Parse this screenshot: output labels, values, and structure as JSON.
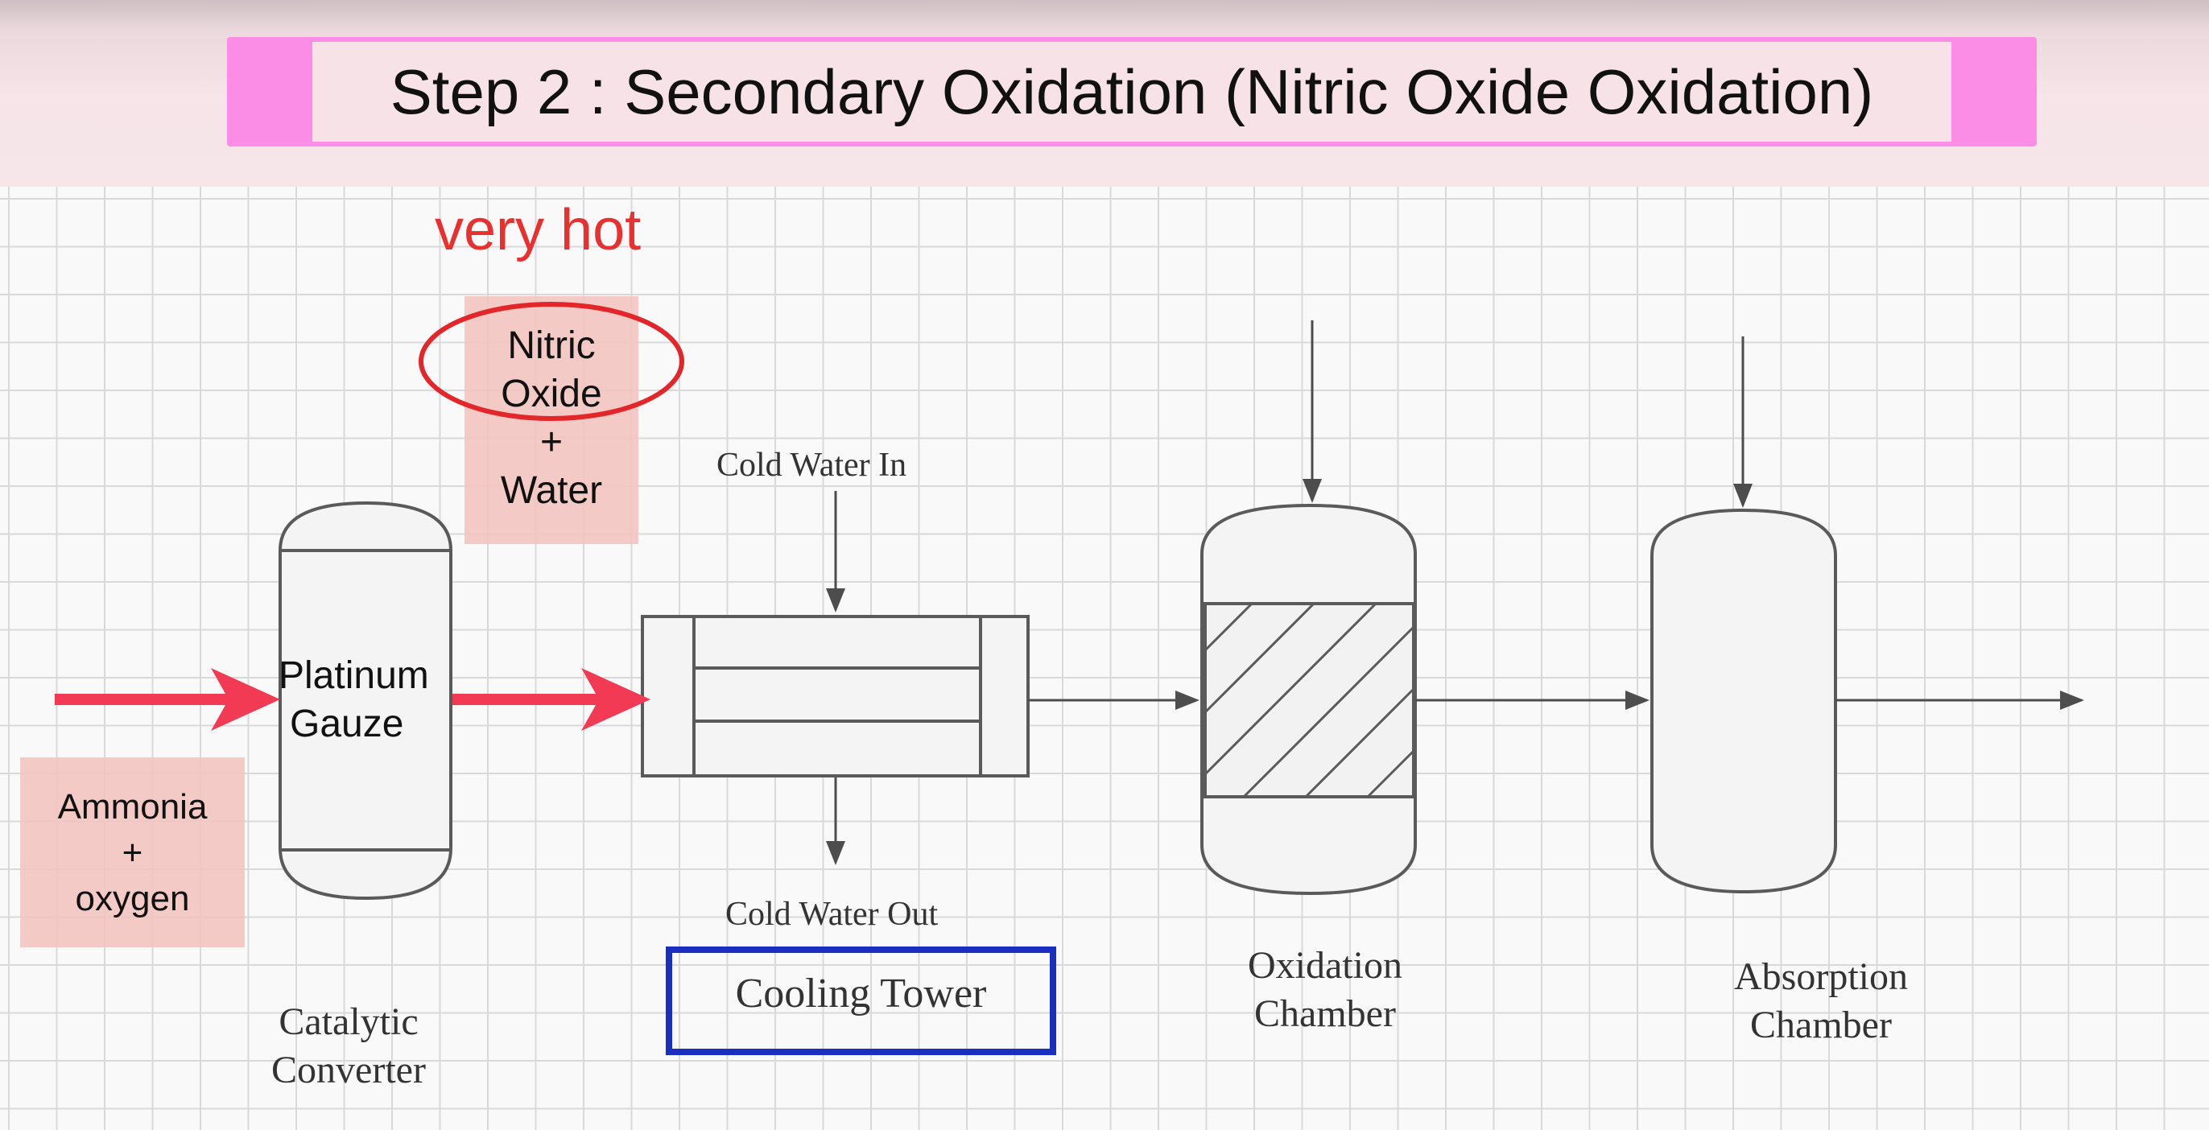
{
  "title": "Step 2 : Secondary Oxidation (Nitric Oxide Oxidation)",
  "annotation": {
    "text": "very hot",
    "color": "#e8312f"
  },
  "notes": {
    "product": {
      "lines": [
        "Nitric",
        "Oxide",
        "+",
        "Water"
      ]
    },
    "feed": {
      "lines": [
        "Ammonia",
        "+",
        "oxygen"
      ]
    }
  },
  "catalyst_label": {
    "lines": [
      "Platinum",
      "Gauze"
    ]
  },
  "cooling": {
    "water_in": "Cold Water In",
    "water_out": "Cold Water Out",
    "name": "Cooling Tower"
  },
  "equipment": {
    "converter": {
      "lines": [
        "Catalytic",
        "Converter"
      ]
    },
    "oxidation": {
      "lines": [
        "Oxidation",
        "Chamber"
      ]
    },
    "absorption": {
      "lines": [
        "Absorption",
        "Chamber"
      ]
    }
  },
  "colors": {
    "title_frame": "#fb8de6",
    "title_box": "#f7e3e7",
    "highlight_arrow": "#f23a55",
    "circle": "#e3262a",
    "note_fill": "#f2c6c1",
    "cooling_box_border": "#1a2fc0",
    "diagram_line": "#4d4d4d"
  }
}
